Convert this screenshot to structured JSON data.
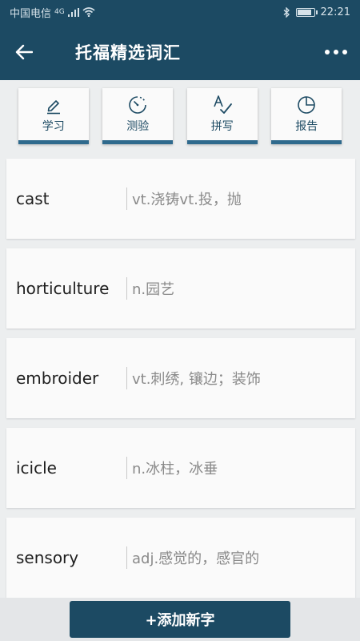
{
  "status_bar": {
    "carrier": "中国电信",
    "network": "4G",
    "time": "22:21"
  },
  "app_bar": {
    "title": "托福精选词汇",
    "back_icon": "arrow-left-icon",
    "menu_icon": "more-horizontal-icon"
  },
  "toolbar": {
    "items": [
      {
        "label": "学习",
        "icon": "pencil-icon"
      },
      {
        "label": "测验",
        "icon": "timer-icon"
      },
      {
        "label": "拼写",
        "icon": "spell-check-icon"
      },
      {
        "label": "报告",
        "icon": "pie-chart-icon"
      }
    ]
  },
  "words": [
    {
      "word": "cast",
      "meaning": "vt.浇铸vt.投，抛"
    },
    {
      "word": "horticulture",
      "meaning": "n.园艺"
    },
    {
      "word": "embroider",
      "meaning": "vt.刺绣, 镶边；装饰"
    },
    {
      "word": "icicle",
      "meaning": "n.冰柱，冰垂"
    },
    {
      "word": "sensory",
      "meaning": "adj.感觉的，感官的"
    }
  ],
  "add_button": {
    "label": "+添加新字"
  },
  "colors": {
    "primary": "#1c4a63",
    "accent": "#2f6a8d",
    "background": "#eceeef"
  }
}
